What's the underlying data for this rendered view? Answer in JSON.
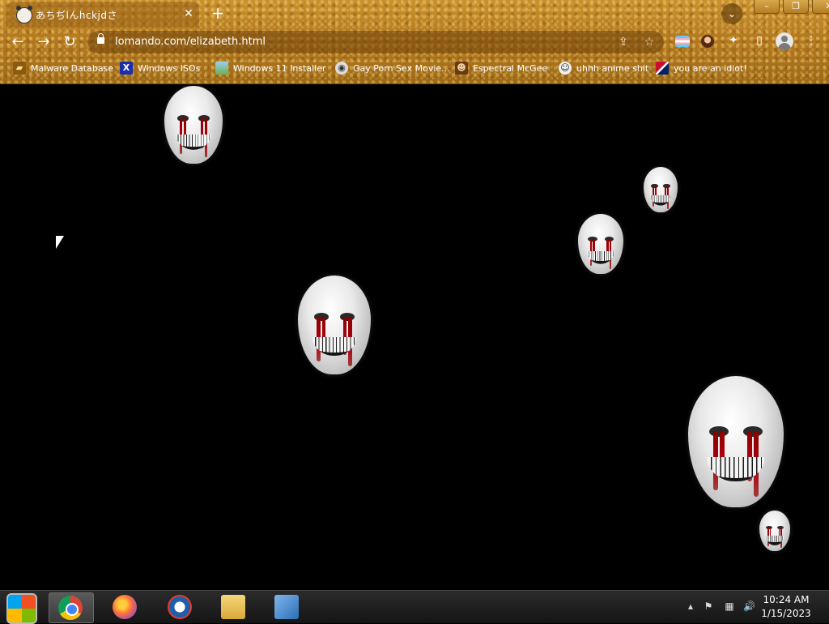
{
  "tab": {
    "title": "あちぢlんhckjdさ",
    "close_glyph": "✕",
    "new_tab_glyph": "+"
  },
  "window_controls": {
    "search_tabs_glyph": "⌄",
    "minimize": "–",
    "restore": "❐",
    "close": "✕"
  },
  "toolbar": {
    "back_glyph": "←",
    "forward_glyph": "→",
    "reload_glyph": "↻",
    "url": "lomando.com/elizabeth.html",
    "share_glyph": "⇪",
    "star_glyph": "☆",
    "puzzle_glyph": "✦",
    "sidepanel_glyph": "▯",
    "menu_glyph": "⋮"
  },
  "bookmarks": [
    {
      "label": "Malware Database",
      "icon": "folder-icon"
    },
    {
      "label": "Windows ISOs",
      "icon": "x-icon"
    },
    {
      "label": "Windows 11 Installer",
      "icon": "image-icon"
    },
    {
      "label": "Gay Porn Sex Movie...",
      "icon": "disc-icon"
    },
    {
      "label": "Espectral McGee",
      "icon": "character-icon"
    },
    {
      "label": "uhhh anime shit",
      "icon": "anime-icon"
    },
    {
      "label": "you are an idiot!",
      "icon": "flag-icon"
    }
  ],
  "taskbar": {
    "clock_time": "10:24 AM",
    "clock_date": "1/15/2023"
  },
  "colors": {
    "chrome_base": "#b57a1f",
    "page_background": "#000000",
    "blood": "#b00010"
  }
}
